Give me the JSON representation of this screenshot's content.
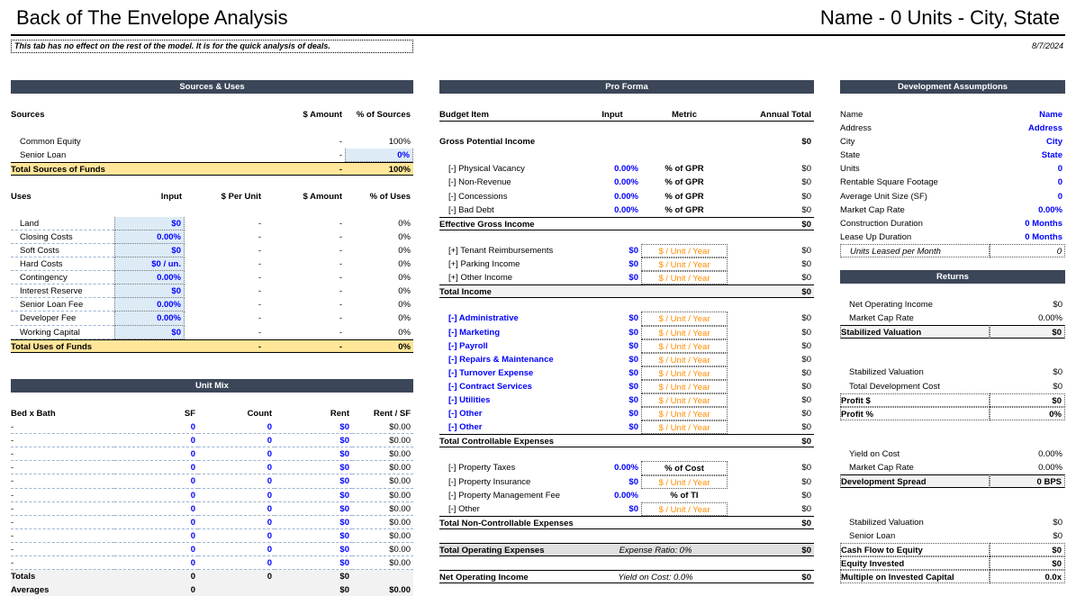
{
  "header": {
    "title": "Back of The Envelope Analysis",
    "right_title": "Name - 0 Units - City, State",
    "note": "This tab has no effect on the rest of the model. It is for the quick analysis of deals.",
    "date": "8/7/2024"
  },
  "sources_uses": {
    "title": "Sources & Uses",
    "sources_head": [
      "Sources",
      "$ Amount",
      "% of Sources"
    ],
    "sources": [
      [
        "Common Equity",
        "-",
        "100%"
      ],
      [
        "Senior Loan",
        "-",
        "0%"
      ]
    ],
    "sources_total": [
      "Total Sources of Funds",
      "-",
      "100%"
    ],
    "uses_head": [
      "Uses",
      "Input",
      "$ Per Unit",
      "$ Amount",
      "% of Uses"
    ],
    "uses": [
      [
        "Land",
        "$0",
        "-",
        "-",
        "0%"
      ],
      [
        "Closing Costs",
        "0.00%",
        "-",
        "-",
        "0%"
      ],
      [
        "Soft Costs",
        "$0",
        "-",
        "-",
        "0%"
      ],
      [
        "Hard Costs",
        "$0 / un.",
        "-",
        "-",
        "0%"
      ],
      [
        "Contingency",
        "0.00%",
        "-",
        "-",
        "0%"
      ],
      [
        "Interest Reserve",
        "$0",
        "-",
        "-",
        "0%"
      ],
      [
        "Senior Loan Fee",
        "0.00%",
        "-",
        "-",
        "0%"
      ],
      [
        "Developer Fee",
        "0.00%",
        "-",
        "-",
        "0%"
      ],
      [
        "Working Capital",
        "$0",
        "-",
        "-",
        "0%"
      ]
    ],
    "uses_total": [
      "Total Uses of Funds",
      "-",
      "-",
      "0%"
    ]
  },
  "unit_mix": {
    "title": "Unit Mix",
    "head": [
      "Bed x Bath",
      "SF",
      "Count",
      "Rent",
      "Rent / SF"
    ],
    "rows": [
      [
        "-",
        "0",
        "0",
        "$0",
        "$0.00"
      ],
      [
        "-",
        "0",
        "0",
        "$0",
        "$0.00"
      ],
      [
        "-",
        "0",
        "0",
        "$0",
        "$0.00"
      ],
      [
        "-",
        "0",
        "0",
        "$0",
        "$0.00"
      ],
      [
        "-",
        "0",
        "0",
        "$0",
        "$0.00"
      ],
      [
        "-",
        "0",
        "0",
        "$0",
        "$0.00"
      ],
      [
        "-",
        "0",
        "0",
        "$0",
        "$0.00"
      ],
      [
        "-",
        "0",
        "0",
        "$0",
        "$0.00"
      ],
      [
        "-",
        "0",
        "0",
        "$0",
        "$0.00"
      ],
      [
        "-",
        "0",
        "0",
        "$0",
        "$0.00"
      ],
      [
        "-",
        "0",
        "0",
        "$0",
        "$0.00"
      ]
    ],
    "totals": [
      "Totals",
      "0",
      "0",
      "$0",
      ""
    ],
    "averages": [
      "Averages",
      "0",
      "",
      "$0",
      "$0.00"
    ]
  },
  "pro_forma": {
    "title": "Pro Forma",
    "head": [
      "Budget Item",
      "Input",
      "Metric",
      "Annual Total"
    ],
    "gpi": [
      "Gross Potential Income",
      "$0"
    ],
    "vacancy": [
      [
        "[-] Physical Vacancy",
        "0.00%",
        "% of GPR",
        "$0"
      ],
      [
        "[-] Non-Revenue",
        "0.00%",
        "% of GPR",
        "$0"
      ],
      [
        "[-] Concessions",
        "0.00%",
        "% of GPR",
        "$0"
      ],
      [
        "[-] Bad Debt",
        "0.00%",
        "% of GPR",
        "$0"
      ]
    ],
    "egi": [
      "Effective Gross Income",
      "$0"
    ],
    "other_income": [
      [
        "[+] Tenant Reimbursements",
        "$0",
        "$ / Unit / Year",
        "$0"
      ],
      [
        "[+] Parking Income",
        "$0",
        "$ / Unit / Year",
        "$0"
      ],
      [
        "[+] Other Income",
        "$0",
        "$ / Unit / Year",
        "$0"
      ]
    ],
    "total_income": [
      "Total Income",
      "$0"
    ],
    "controllable": [
      [
        "[-] Administrative",
        "$0",
        "$ / Unit / Year",
        "$0"
      ],
      [
        "[-] Marketing",
        "$0",
        "$ / Unit / Year",
        "$0"
      ],
      [
        "[-] Payroll",
        "$0",
        "$ / Unit / Year",
        "$0"
      ],
      [
        "[-] Repairs & Maintenance",
        "$0",
        "$ / Unit / Year",
        "$0"
      ],
      [
        "[-] Turnover Expense",
        "$0",
        "$ / Unit / Year",
        "$0"
      ],
      [
        "[-] Contract Services",
        "$0",
        "$ / Unit / Year",
        "$0"
      ],
      [
        "[-] Utilities",
        "$0",
        "$ / Unit / Year",
        "$0"
      ],
      [
        "[-] Other",
        "$0",
        "$ / Unit / Year",
        "$0"
      ],
      [
        "[-] Other",
        "$0",
        "$ / Unit / Year",
        "$0"
      ]
    ],
    "tce": [
      "Total Controllable Expenses",
      "$0"
    ],
    "noncontrollable": [
      [
        "[-] Property Taxes",
        "0.00%",
        "% of Cost",
        "$0"
      ],
      [
        "[-] Property Insurance",
        "$0",
        "$ / Unit / Year",
        "$0"
      ],
      [
        "[-] Property Management Fee",
        "0.00%",
        "% of TI",
        "$0"
      ],
      [
        "[-] Other",
        "$0",
        "$ / Unit / Year",
        "$0"
      ]
    ],
    "tnce": [
      "Total Non-Controllable Expenses",
      "$0"
    ],
    "toe": [
      "Total Operating Expenses",
      "Expense Ratio: 0%",
      "$0"
    ],
    "noi": [
      "Net Operating Income",
      "Yield on Cost: 0.0%",
      "$0"
    ]
  },
  "dev": {
    "title": "Development Assumptions",
    "rows": [
      [
        "Name",
        "Name"
      ],
      [
        "Address",
        "Address"
      ],
      [
        "City",
        "City"
      ],
      [
        "State",
        "State"
      ],
      [
        "Units",
        "0"
      ],
      [
        "Rentable Square Footage",
        "0"
      ],
      [
        "Average Unit Size (SF)",
        "0"
      ],
      [
        "Market Cap Rate",
        "0.00%"
      ],
      [
        "Construction Duration",
        "0 Months"
      ],
      [
        "Lease Up Duration",
        "0 Months"
      ],
      [
        "Units Leased per Month",
        "0"
      ]
    ]
  },
  "returns": {
    "title": "Returns",
    "g1": [
      [
        "Net Operating Income",
        "$0"
      ],
      [
        "Market Cap Rate",
        "0.00%"
      ]
    ],
    "g1t": [
      "Stabilized Valuation",
      "$0"
    ],
    "g2": [
      [
        "Stabilized Valuation",
        "$0"
      ],
      [
        "Total Development Cost",
        "$0"
      ]
    ],
    "g2t": [
      [
        "Profit $",
        "$0"
      ],
      [
        "Profit %",
        "0%"
      ]
    ],
    "g3": [
      [
        "Yield on Cost",
        "0.00%"
      ],
      [
        "Market Cap Rate",
        "0.00%"
      ]
    ],
    "g3t": [
      "Development Spread",
      "0 BPS"
    ],
    "g4": [
      [
        "Stabilized Valuation",
        "$0"
      ],
      [
        "Senior Loan",
        "$0"
      ]
    ],
    "g4t": [
      [
        "Cash Flow to Equity",
        "$0"
      ],
      [
        "Equity Invested",
        "$0"
      ],
      [
        "Multiple on Invested Capital",
        "0.0x"
      ]
    ]
  }
}
